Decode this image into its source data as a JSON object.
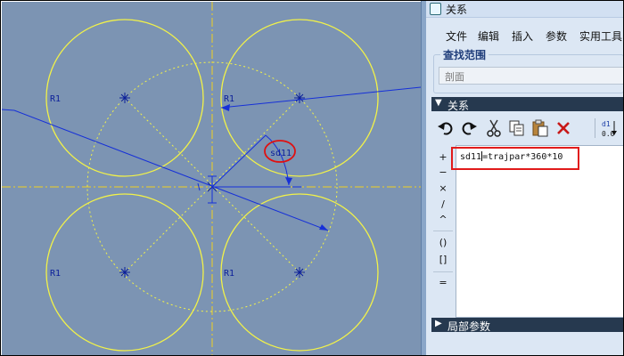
{
  "viewport": {
    "circle_labels": [
      "R1",
      "R1",
      "R1",
      "R1"
    ],
    "dimension_label": "sd11",
    "colors": {
      "background": "#7c94b3",
      "circle": "#f2f248",
      "dimension": "#1630d8",
      "axis": "#f0d020",
      "annotation": "#e01010"
    }
  },
  "dialog": {
    "title": "关系",
    "menu": [
      "文件",
      "编辑",
      "插入",
      "参数",
      "实用工具"
    ],
    "scope": {
      "legend": "查找范围",
      "value": "剖面"
    },
    "relations_section": "关系",
    "toolbar_icons": [
      "undo-icon",
      "redo-icon",
      "cut-icon",
      "copy-icon",
      "paste-icon",
      "delete-icon",
      "sort-relations-icon"
    ],
    "operators": [
      "+",
      "−",
      "×",
      "/",
      "^",
      "()",
      "[]",
      "="
    ],
    "relation_text_before_caret": "sd11",
    "relation_text_after_caret": "=trajpar*360*10",
    "local_params_section": "局部参数"
  }
}
